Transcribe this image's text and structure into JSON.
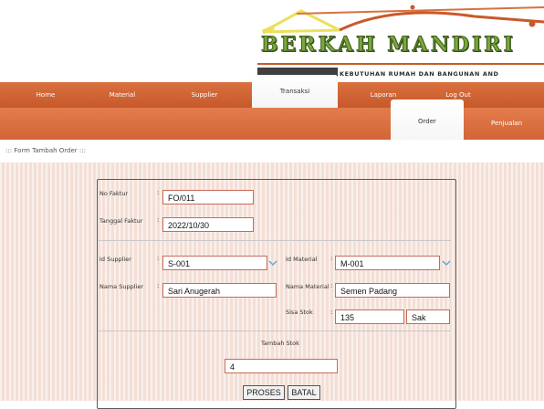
{
  "header": {
    "brand_title": "BERKAH MANDIRI",
    "brand_subtitle": "KEBUTUHAN RUMAH DAN BANGUNAN AND"
  },
  "nav": {
    "items": [
      {
        "label": "Home"
      },
      {
        "label": "Material"
      },
      {
        "label": "Supplier"
      },
      {
        "label": "Transaksi"
      },
      {
        "label": "Laporan"
      },
      {
        "label": "Log Out"
      }
    ],
    "active": "Transaksi"
  },
  "subnav": {
    "items": [
      {
        "label": "Order"
      },
      {
        "label": "Penjualan"
      }
    ],
    "active": "Order"
  },
  "breadcrumb": "::: Form Tambah Order :::",
  "form": {
    "no_faktur": {
      "label": "No Faktur",
      "value": "FO/011"
    },
    "tanggal_faktur": {
      "label": "Tanggal Faktur",
      "value": "2022/10/30"
    },
    "id_supplier": {
      "label": "Id Supplier",
      "value": "S-001"
    },
    "nama_supplier": {
      "label": "Nama Supplier",
      "value": "Sari Anugerah"
    },
    "id_material": {
      "label": "Id Material",
      "value": "M-001"
    },
    "nama_material": {
      "label": "Nama Material",
      "value": "Semen Padang"
    },
    "sisa_stok": {
      "label": "Sisa Stok",
      "value": "135",
      "unit": "Sak"
    },
    "tambah_stok": {
      "label": "Tambah Stok",
      "value": "4"
    },
    "colon": ":",
    "buttons": {
      "proses": "PROSES",
      "batal": "BATAL"
    }
  },
  "colors": {
    "nav": "#c7592b",
    "subnav": "#d36537",
    "content_bg": "#f3dfd6",
    "field_border": "#c86a5a",
    "brand_green": "#79a83a"
  }
}
